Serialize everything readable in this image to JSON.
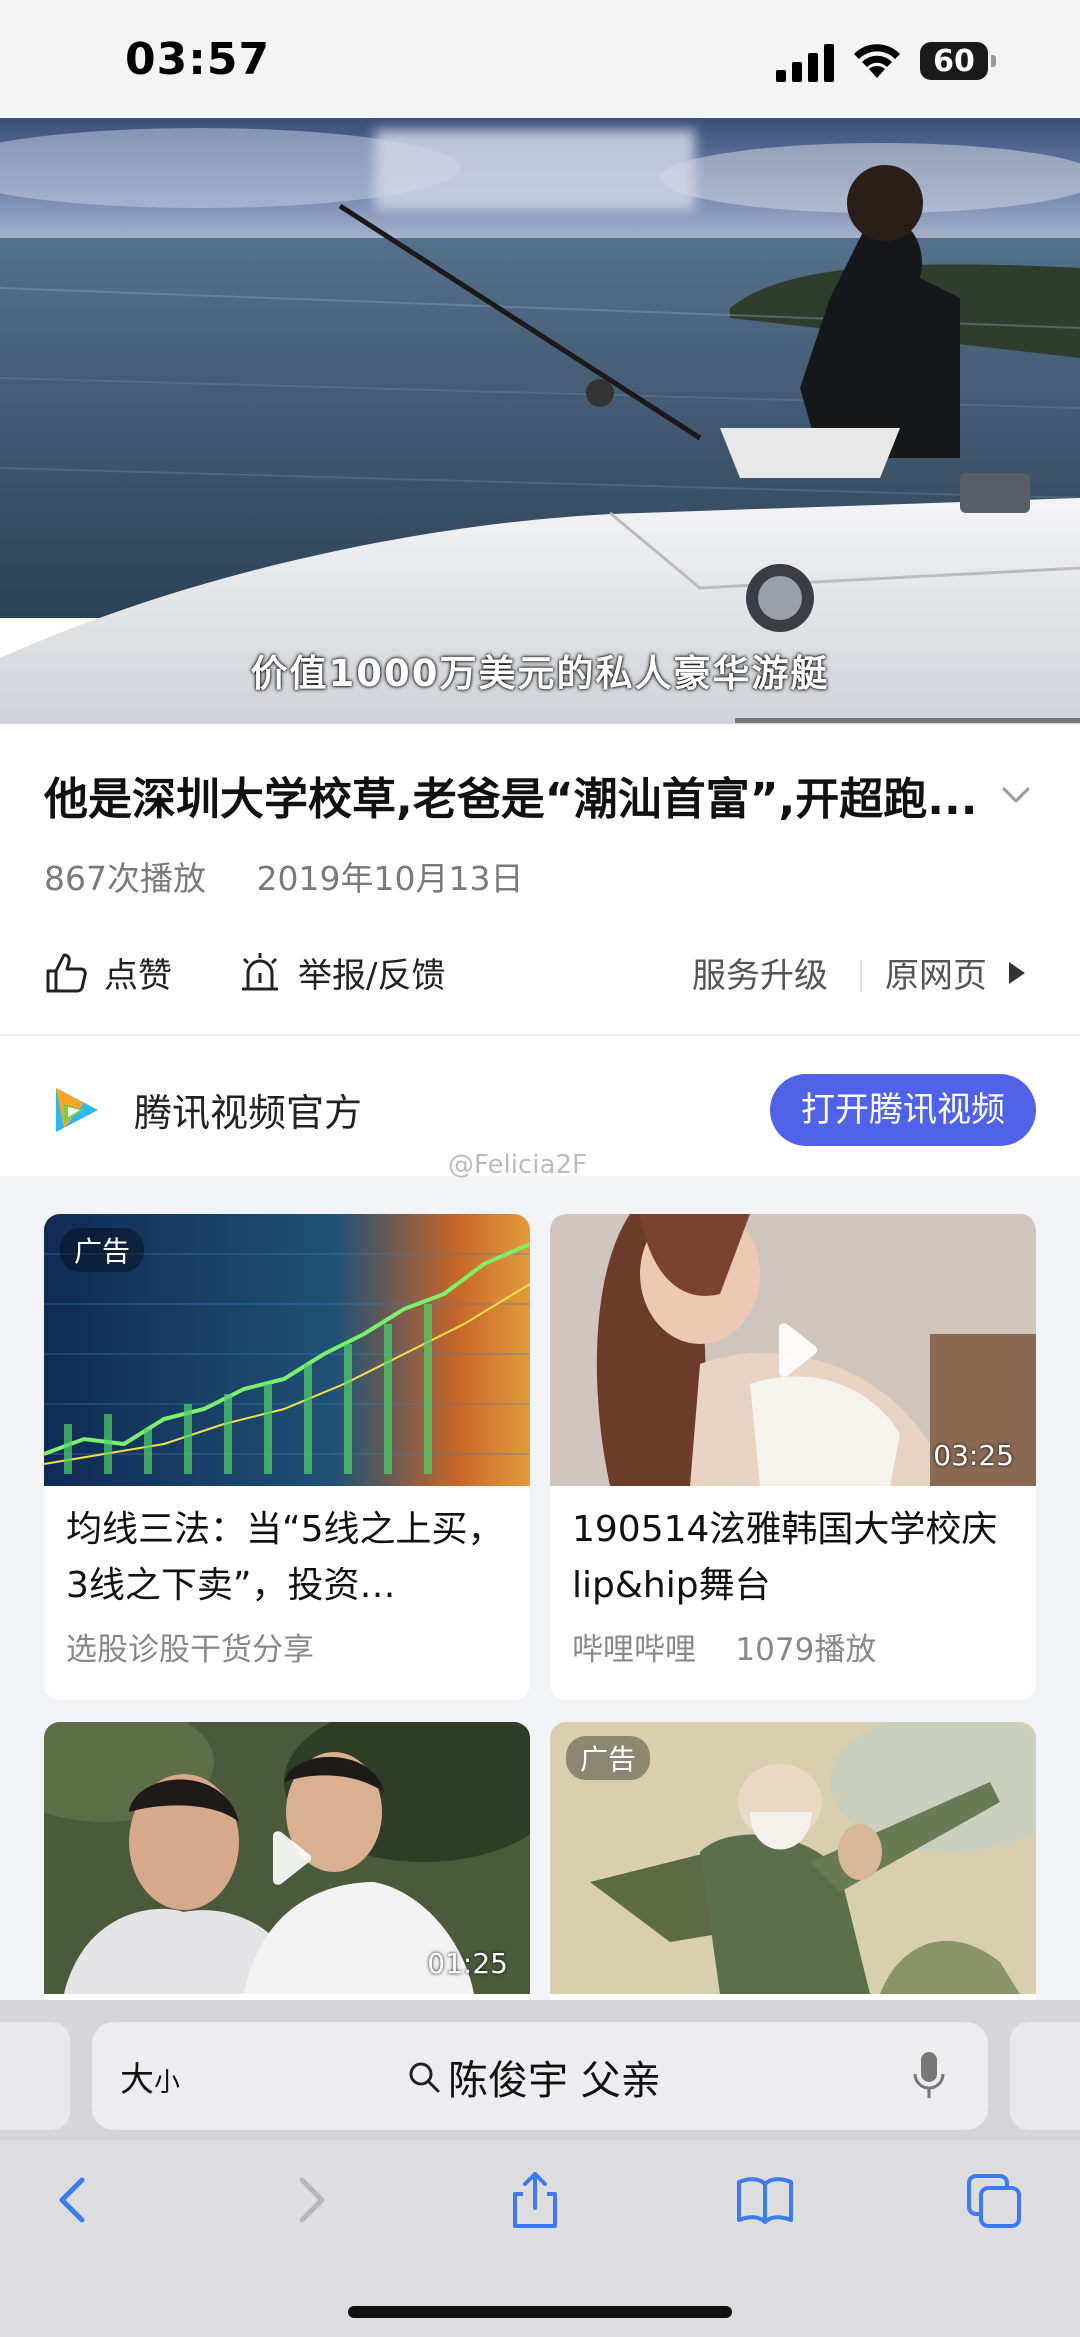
{
  "status_bar": {
    "time": "03:57",
    "battery": "60"
  },
  "video": {
    "caption": "价值1000万美元的私人豪华游艇",
    "title": "他是深圳大学校草,老爸是“潮汕首富”,开超跑...",
    "plays": "867次播放",
    "date": "2019年10月13日"
  },
  "actions": {
    "like": "点赞",
    "report": "举报/反馈",
    "upgrade": "服务升级",
    "original": "原网页"
  },
  "channel": {
    "name": "腾讯视频官方",
    "open_button": "打开腾讯视频"
  },
  "watermark": "@Felicia2F",
  "feed": [
    {
      "ad": "广告",
      "title": "均线三法：当“5线之上买，3线之下卖”，投资…",
      "sub": "选股诊股干货分享"
    },
    {
      "duration": "03:25",
      "title": "190514泫雅韩国大学校庆lip&hip舞台",
      "source": "哔哩哔哩",
      "plays": "1079播放"
    },
    {
      "duration": "01:25"
    },
    {
      "ad": "广告"
    }
  ],
  "browser": {
    "text_size_big": "大",
    "text_size_small": "小",
    "search_query": "陈俊宇 父亲"
  }
}
